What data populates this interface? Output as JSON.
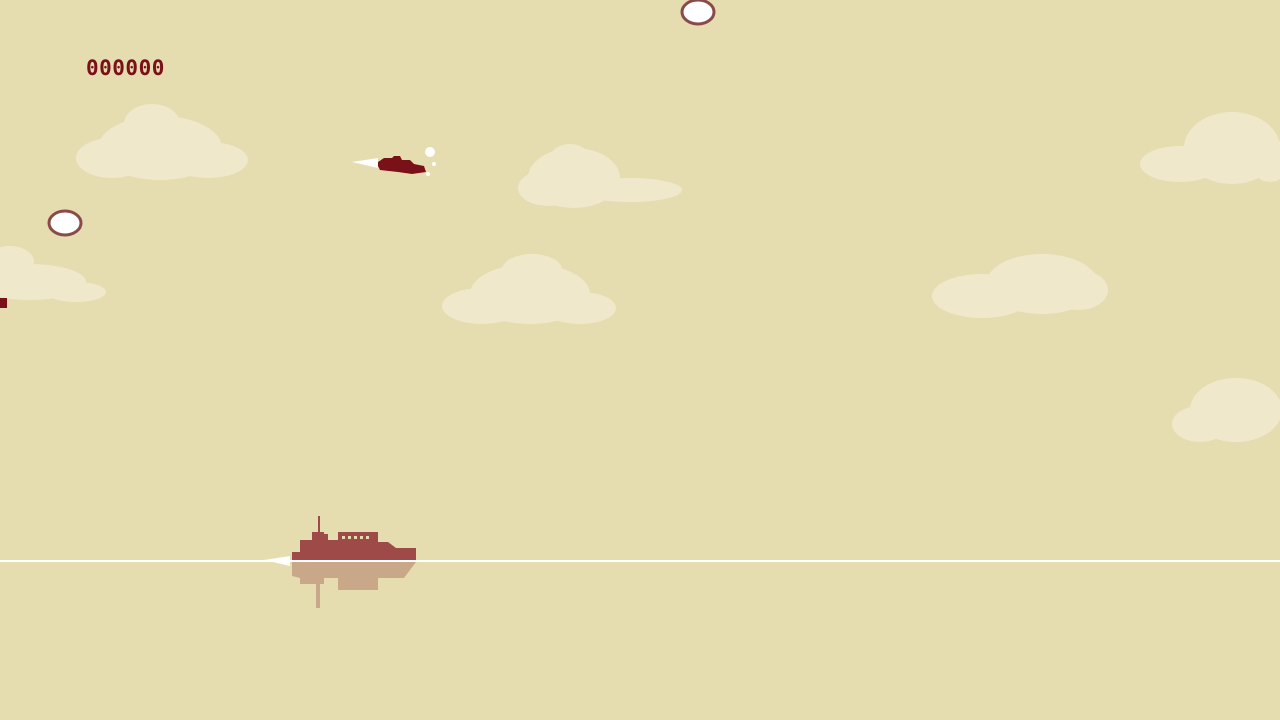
{
  "hud": {
    "score": "000000"
  },
  "palette": {
    "sky": "#e5ddb0",
    "cloud": "#f0e8ca",
    "ink": "#7a1018",
    "ship": "#9e4a48",
    "reflection": "#c9a88a",
    "horizon": "#ffffff",
    "orb_fill": "#ffffff",
    "orb_ring": "#8a4a4a"
  },
  "sprites": {
    "player": "player-plane",
    "ship": "enemy-battleship",
    "orb": "enemy-orb"
  }
}
